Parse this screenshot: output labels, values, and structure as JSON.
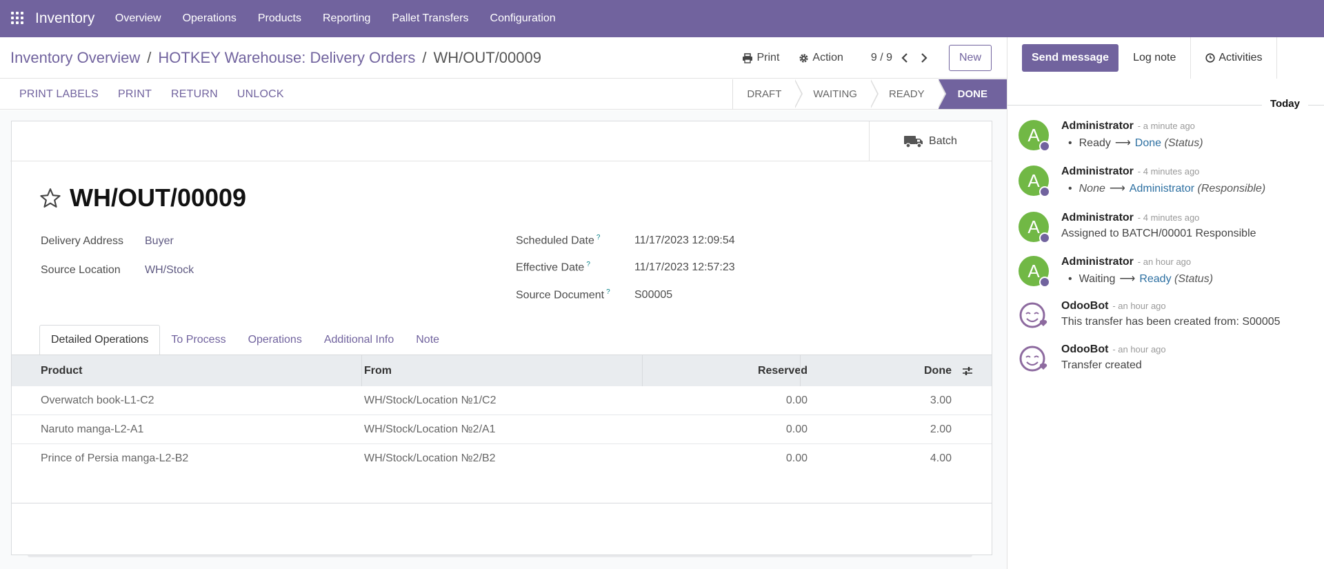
{
  "navbar": {
    "brand": "Inventory",
    "menu": [
      "Overview",
      "Operations",
      "Products",
      "Reporting",
      "Pallet Transfers",
      "Configuration"
    ],
    "bg_color": "#71639e"
  },
  "breadcrumb": {
    "items": [
      "Inventory Overview",
      "HOTKEY Warehouse: Delivery Orders"
    ],
    "current": "WH/OUT/00009",
    "separator": "/"
  },
  "control": {
    "print_label": "Print",
    "action_label": "Action",
    "pager": "9 / 9",
    "new_label": "New"
  },
  "actions": [
    "PRINT LABELS",
    "PRINT",
    "RETURN",
    "UNLOCK"
  ],
  "statusbar": {
    "stages": [
      "DRAFT",
      "WAITING",
      "READY",
      "DONE"
    ],
    "current": "DONE"
  },
  "form": {
    "batch_label": "Batch",
    "title": "WH/OUT/00009",
    "left_fields": [
      {
        "label": "Delivery Address",
        "value": "Buyer"
      },
      {
        "label": "Source Location",
        "value": "WH/Stock"
      }
    ],
    "right_fields": [
      {
        "label": "Scheduled Date",
        "help": "?",
        "value": "11/17/2023 12:09:54"
      },
      {
        "label": "Effective Date",
        "help": "?",
        "value": "11/17/2023 12:57:23"
      },
      {
        "label": "Source Document",
        "help": "?",
        "value": "S00005"
      }
    ]
  },
  "tabs": [
    "Detailed Operations",
    "To Process",
    "Operations",
    "Additional Info",
    "Note"
  ],
  "table": {
    "headers": {
      "product": "Product",
      "from": "From",
      "reserved": "Reserved",
      "done": "Done"
    },
    "rows": [
      {
        "product": "Overwatch book-L1-C2",
        "from": "WH/Stock/Location №1/C2",
        "reserved": "0.00",
        "done": "3.00"
      },
      {
        "product": "Naruto manga-L2-A1",
        "from": "WH/Stock/Location №2/A1",
        "reserved": "0.00",
        "done": "2.00"
      },
      {
        "product": "Prince of Persia manga-L2-B2",
        "from": "WH/Stock/Location №2/B2",
        "reserved": "0.00",
        "done": "4.00"
      }
    ]
  },
  "chatter": {
    "send_label": "Send message",
    "log_label": "Log note",
    "activities_label": "Activities",
    "today_label": "Today",
    "messages": [
      {
        "author": "Administrator",
        "when": "- a minute ago",
        "kind": "tracking",
        "old": "Ready",
        "new": "Done",
        "field": "(Status)"
      },
      {
        "author": "Administrator",
        "when": "- 4 minutes ago",
        "kind": "tracking",
        "old": "None",
        "new": "Administrator",
        "field": "(Responsible)"
      },
      {
        "author": "Administrator",
        "when": "- 4 minutes ago",
        "kind": "text",
        "text": "Assigned to BATCH/00001 Responsible"
      },
      {
        "author": "Administrator",
        "when": "- an hour ago",
        "kind": "tracking",
        "old": "Waiting",
        "new": "Ready",
        "field": "(Status)"
      },
      {
        "author": "OdooBot",
        "when": "- an hour ago",
        "kind": "text",
        "text": "This transfer has been created from: S00005"
      },
      {
        "author": "OdooBot",
        "when": "- an hour ago",
        "kind": "text",
        "text": "Transfer created"
      }
    ],
    "avatar_letter": "A"
  }
}
